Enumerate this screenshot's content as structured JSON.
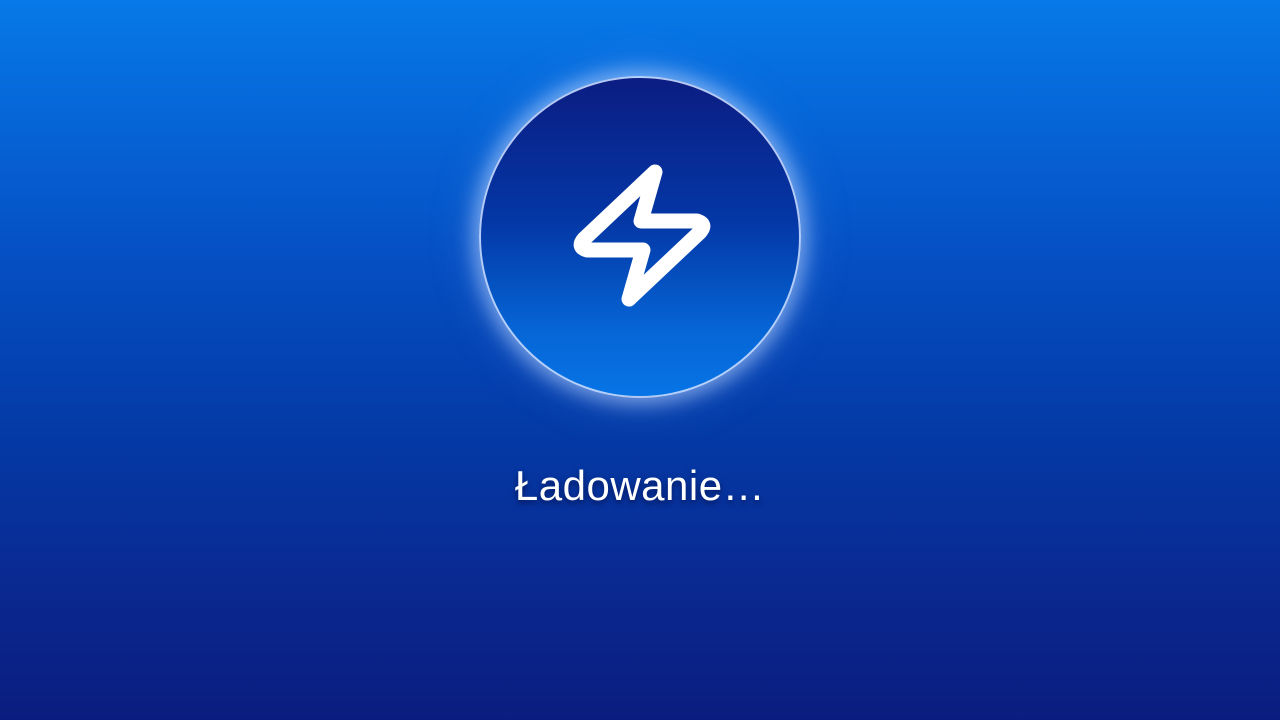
{
  "loader": {
    "icon": "lightning-bolt-icon",
    "status_text": "Ładowanie…"
  },
  "colors": {
    "background_top": "#0779e8",
    "background_bottom": "#0a1d7f",
    "circle_top": "#0b1d82",
    "circle_bottom": "#0774e6",
    "icon": "#ffffff",
    "text": "#ffffff"
  }
}
